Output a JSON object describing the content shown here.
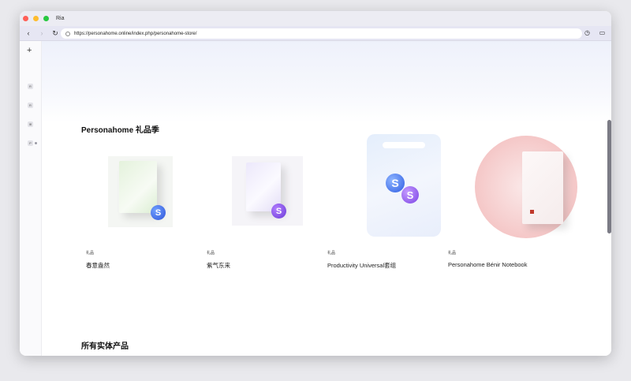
{
  "window": {
    "title": "Ria",
    "traffic_colors": [
      "#ff5f57",
      "#febc2e",
      "#28c840"
    ]
  },
  "toolbar": {
    "back_icon": "‹",
    "forward_icon": "›",
    "reload_icon": "↻",
    "url": "https://personahome.online/index.php/personahome-store/",
    "history_icon": "◷",
    "chat_icon": "▭"
  },
  "sidebar": {
    "new_tab_icon": "+",
    "items": [
      {
        "label": "R"
      },
      {
        "label": "R"
      },
      {
        "label": "⊞"
      },
      {
        "label": "P"
      }
    ]
  },
  "store": {
    "gift_section_title": "Personahome 礼品季",
    "products": [
      {
        "tag": "礼品",
        "name": "春意盎然"
      },
      {
        "tag": "礼品",
        "name": "紫气东来"
      },
      {
        "tag": "礼品",
        "name": "Productivity Universal套组"
      },
      {
        "tag": "礼品",
        "name": "Personahome Bénir Notebook"
      }
    ],
    "all_products_title": "所有实体产品"
  },
  "colors": {
    "accent_blue": "#3a5be0",
    "accent_purple": "#8a4fe0",
    "notebook_red": "#c0392b"
  }
}
